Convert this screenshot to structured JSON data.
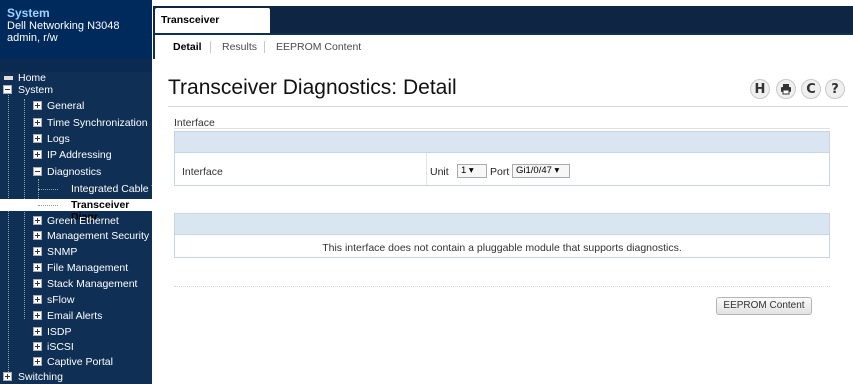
{
  "system": {
    "title": "System",
    "device": "Dell Networking N3048",
    "user": "admin, r/w"
  },
  "tree": {
    "home": "Home",
    "system": "System",
    "items": [
      "General",
      "Time Synchronization",
      "Logs",
      "IP Addressing",
      "Diagnostics",
      "Integrated Cable Te",
      "Transceiver Diagr",
      "Green Ethernet",
      "Management Security",
      "SNMP",
      "File Management",
      "Stack Management",
      "sFlow",
      "Email Alerts",
      "ISDP",
      "iSCSI",
      "Captive Portal"
    ],
    "switching": "Switching"
  },
  "tabs": {
    "main": "Transceiver Diagnostics",
    "sub": [
      "Detail",
      "Results",
      "EEPROM Content"
    ]
  },
  "page": {
    "title": "Transceiver Diagnostics: Detail",
    "toolbar_icons": [
      "H",
      "printer-icon",
      "C",
      "?"
    ]
  },
  "interface_section": {
    "label": "Interface",
    "row_label": "Interface",
    "unit_label": "Unit",
    "unit_value": "1 ▾",
    "port_label": "Port",
    "port_value": "Gi1/0/47 ▾"
  },
  "result": {
    "message": "This interface does not contain a pluggable module that supports diagnostics."
  },
  "buttons": {
    "eeprom": "EEPROM Content"
  }
}
